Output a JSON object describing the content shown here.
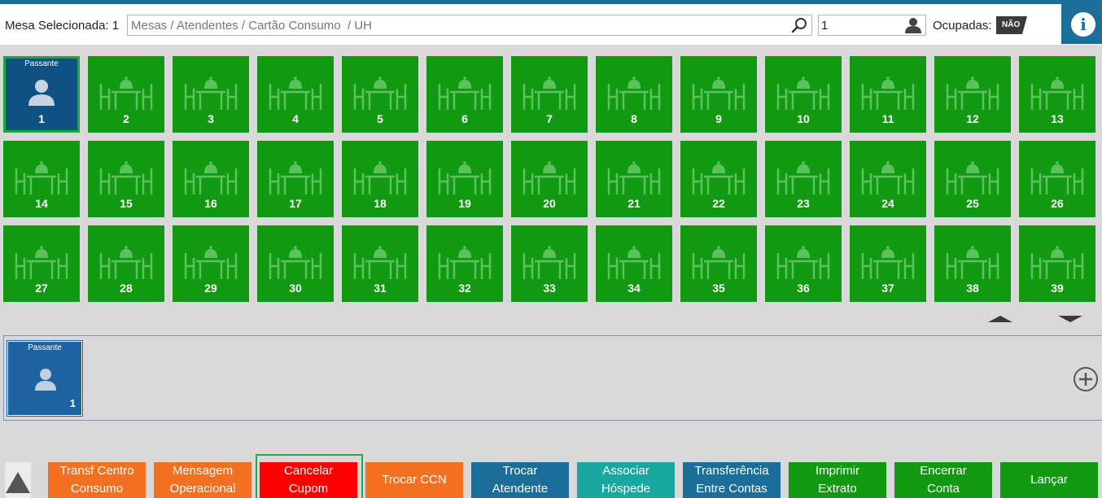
{
  "header": {
    "mesa_selecionada_label": "Mesa Selecionada: 1",
    "search_placeholder": "Mesas / Atendentes / Cartão Consumo  / UH",
    "search_value": "",
    "attendant_value": "1",
    "ocupadas_label": "Ocupadas:",
    "ocupadas_toggle": "NÃO",
    "info_label": "i"
  },
  "tiles": {
    "selected_badge": "Passante",
    "numbers": [
      "1",
      "2",
      "3",
      "4",
      "5",
      "6",
      "7",
      "8",
      "9",
      "10",
      "11",
      "12",
      "13",
      "14",
      "15",
      "16",
      "17",
      "18",
      "19",
      "20",
      "21",
      "22",
      "23",
      "24",
      "25",
      "26",
      "27",
      "28",
      "29",
      "30",
      "31",
      "32",
      "33",
      "34",
      "35",
      "36",
      "37",
      "38",
      "39"
    ]
  },
  "panel": {
    "card_badge": "Passante",
    "card_number": "1"
  },
  "actions": [
    {
      "line1": "Transf Centro",
      "line2": "Consumo",
      "color": "#f37021"
    },
    {
      "line1": "Mensagem",
      "line2": "Operacional",
      "color": "#f37021"
    },
    {
      "line1": "Cancelar",
      "line2": "Cupom",
      "color": "#fe0000"
    },
    {
      "line1": "Trocar CCN",
      "line2": "",
      "color": "#f37021"
    },
    {
      "line1": "Trocar",
      "line2": "Atendente",
      "color": "#1c6e9a"
    },
    {
      "line1": "Associar",
      "line2": "Hóspede",
      "color": "#19a8a0"
    },
    {
      "line1": "Transferência",
      "line2": "Entre Contas",
      "color": "#1c6e9a"
    },
    {
      "line1": "Imprimir",
      "line2": "Extrato",
      "color": "#119a11"
    },
    {
      "line1": "Encerrar",
      "line2": "Conta",
      "color": "#119a11"
    },
    {
      "line1": "Lançar",
      "line2": "",
      "color": "#119a11"
    }
  ],
  "colors": {
    "accent": "#1c6e9a",
    "free_table": "#119a11",
    "selected_table": "#0f5083",
    "selection_border": "#18a93a"
  }
}
